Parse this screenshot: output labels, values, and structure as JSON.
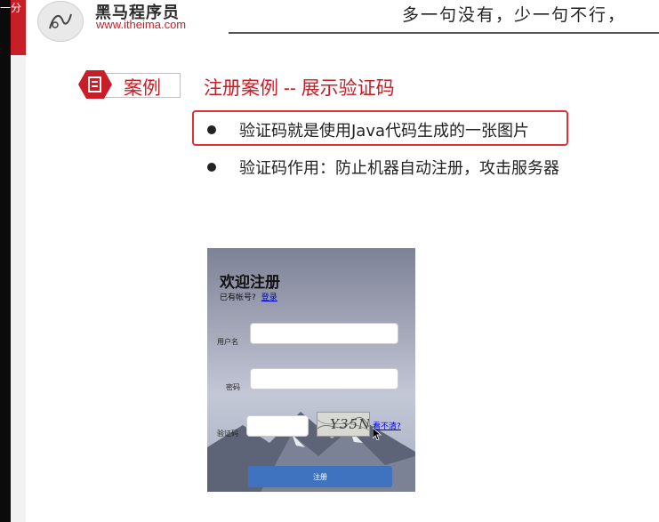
{
  "header": {
    "top_fragment": "一分",
    "brand_name": "黑马程序员",
    "brand_url": "www.itheima.com",
    "slogan": "多一句没有，少一句不行，"
  },
  "slide": {
    "case_label": "案例",
    "title": "注册案例 -- 展示验证码",
    "bullets": [
      "验证码就是使用Java代码生成的一张图片",
      "验证码作用：防止机器自动注册，攻击服务器"
    ],
    "highlight_color": "#e0303a",
    "accent_color": "#c81e28"
  },
  "form": {
    "title": "欢迎注册",
    "have_account": "已有帐号?",
    "login_link": "登录",
    "username_label": "用户名",
    "password_label": "密码",
    "captcha_label": "验证码",
    "captcha_text": "Y35N",
    "refresh_link": "看不清?",
    "submit_label": "注册",
    "button_color": "#3f73c0"
  }
}
